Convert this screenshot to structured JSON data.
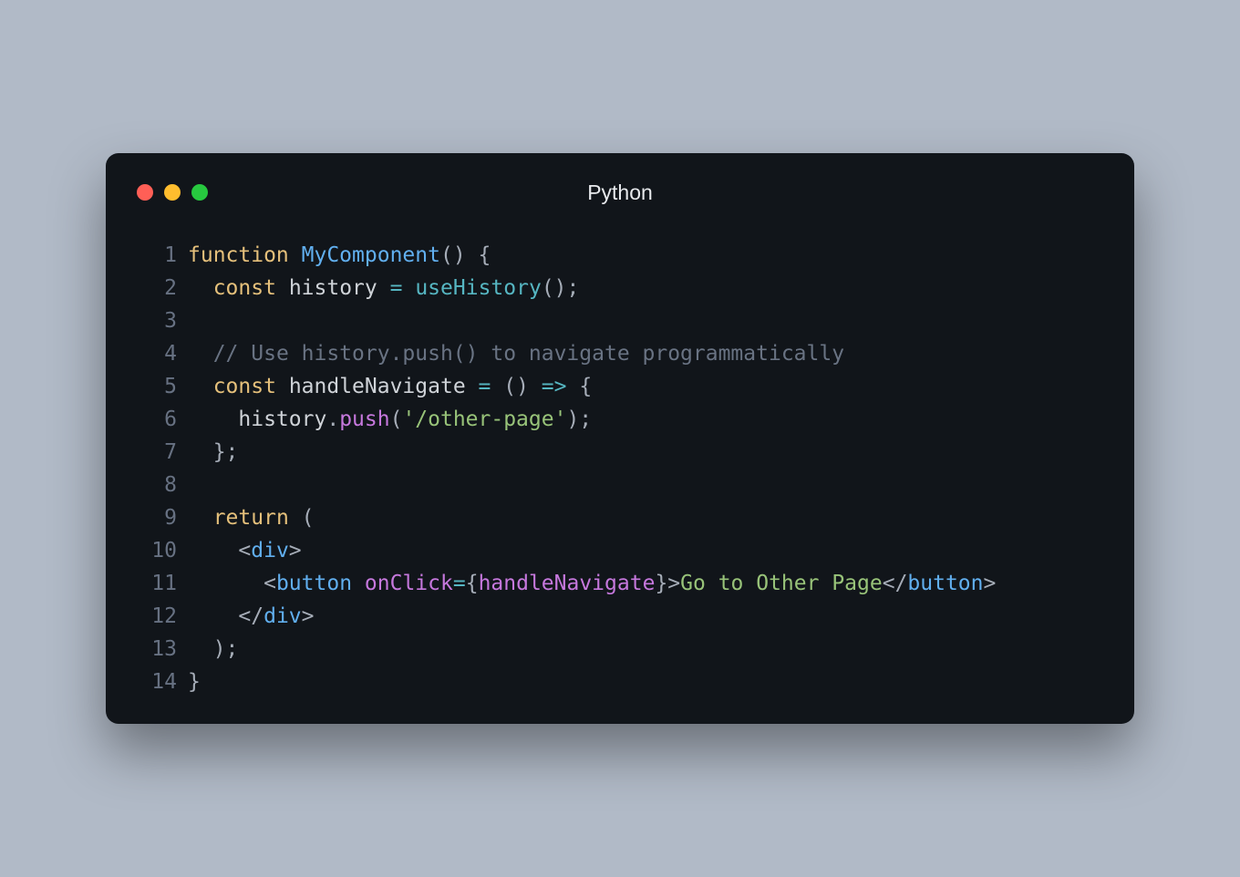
{
  "window": {
    "title": "Python"
  },
  "code": {
    "lines": [
      {
        "n": 1,
        "tokens": [
          [
            "kw",
            "function"
          ],
          [
            "punct",
            " "
          ],
          [
            "fn",
            "MyComponent"
          ],
          [
            "punct",
            "() {"
          ]
        ]
      },
      {
        "n": 2,
        "tokens": [
          [
            "punct",
            "  "
          ],
          [
            "kw",
            "const"
          ],
          [
            "punct",
            " "
          ],
          [
            "ident",
            "history"
          ],
          [
            "punct",
            " "
          ],
          [
            "op",
            "="
          ],
          [
            "punct",
            " "
          ],
          [
            "use",
            "useHistory"
          ],
          [
            "punct",
            "();"
          ]
        ]
      },
      {
        "n": 3,
        "tokens": [
          [
            "punct",
            ""
          ]
        ]
      },
      {
        "n": 4,
        "tokens": [
          [
            "punct",
            "  "
          ],
          [
            "comment",
            "// Use history.push() to navigate programmatically"
          ]
        ]
      },
      {
        "n": 5,
        "tokens": [
          [
            "punct",
            "  "
          ],
          [
            "kw",
            "const"
          ],
          [
            "punct",
            " "
          ],
          [
            "ident",
            "handleNavigate"
          ],
          [
            "punct",
            " "
          ],
          [
            "op",
            "="
          ],
          [
            "punct",
            " () "
          ],
          [
            "op",
            "=>"
          ],
          [
            "punct",
            " {"
          ]
        ]
      },
      {
        "n": 6,
        "tokens": [
          [
            "punct",
            "    "
          ],
          [
            "ident",
            "history"
          ],
          [
            "punct",
            "."
          ],
          [
            "call",
            "push"
          ],
          [
            "punct",
            "("
          ],
          [
            "str",
            "'/other-page'"
          ],
          [
            "punct",
            ");"
          ]
        ]
      },
      {
        "n": 7,
        "tokens": [
          [
            "punct",
            "  };"
          ]
        ]
      },
      {
        "n": 8,
        "tokens": [
          [
            "punct",
            ""
          ]
        ]
      },
      {
        "n": 9,
        "tokens": [
          [
            "punct",
            "  "
          ],
          [
            "kw",
            "return"
          ],
          [
            "punct",
            " ("
          ]
        ]
      },
      {
        "n": 10,
        "tokens": [
          [
            "punct",
            "    "
          ],
          [
            "tagpunc",
            "<"
          ],
          [
            "fn",
            "div"
          ],
          [
            "tagpunc",
            ">"
          ]
        ]
      },
      {
        "n": 11,
        "wrap": true,
        "tokens": [
          [
            "punct",
            "      "
          ],
          [
            "tagpunc",
            "<"
          ],
          [
            "fn",
            "button"
          ],
          [
            "punct",
            " "
          ],
          [
            "attr",
            "onClick"
          ],
          [
            "op",
            "="
          ],
          [
            "punct",
            "{"
          ],
          [
            "call",
            "handleNavigate"
          ],
          [
            "punct",
            "}"
          ],
          [
            "tagpunc",
            ">"
          ],
          [
            "str",
            "Go to Other Page"
          ],
          [
            "tagpunc",
            "</"
          ],
          [
            "fn",
            "button"
          ],
          [
            "tagpunc",
            ">"
          ]
        ]
      },
      {
        "n": 12,
        "tokens": [
          [
            "punct",
            "    "
          ],
          [
            "tagpunc",
            "</"
          ],
          [
            "fn",
            "div"
          ],
          [
            "tagpunc",
            ">"
          ]
        ]
      },
      {
        "n": 13,
        "tokens": [
          [
            "punct",
            "  );"
          ]
        ]
      },
      {
        "n": 14,
        "tokens": [
          [
            "punct",
            "}"
          ]
        ]
      }
    ]
  }
}
